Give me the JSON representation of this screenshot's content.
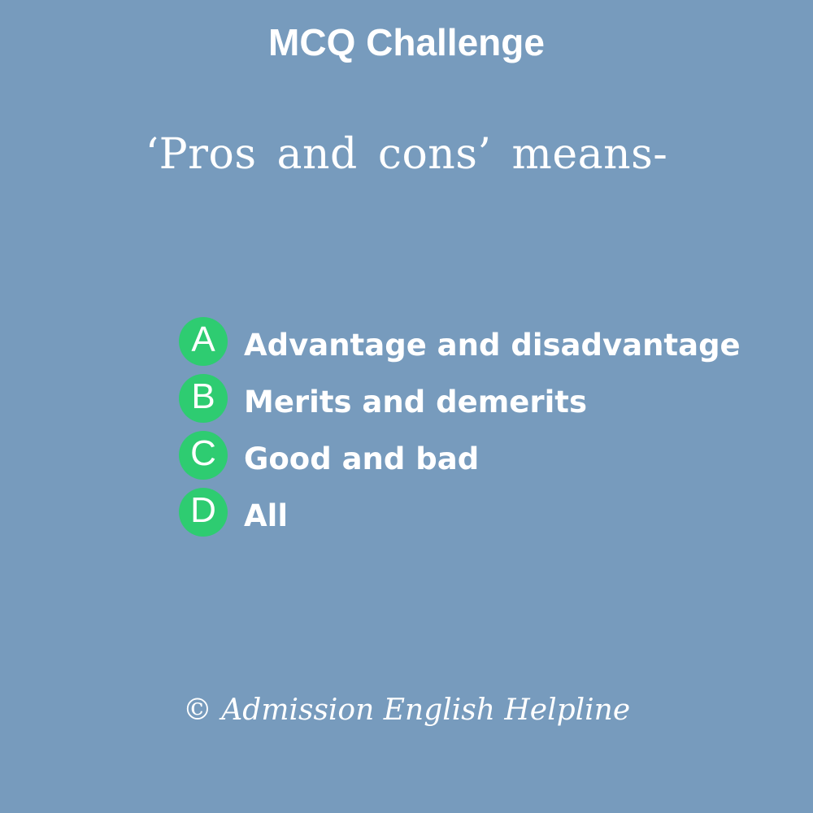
{
  "header": {
    "title": "MCQ Challenge"
  },
  "question": {
    "text": "‘Pros and cons’ means-"
  },
  "options": [
    {
      "letter": "A",
      "text": "Advantage and disadvantage"
    },
    {
      "letter": "B",
      "text": "Merits and demerits"
    },
    {
      "letter": "C",
      "text": "Good and bad"
    },
    {
      "letter": "D",
      "text": "All"
    }
  ],
  "footer": {
    "credit": "© Admission English Helpline"
  },
  "colors": {
    "background": "#779bbd",
    "badge": "#2ecc71",
    "text": "#ffffff"
  }
}
